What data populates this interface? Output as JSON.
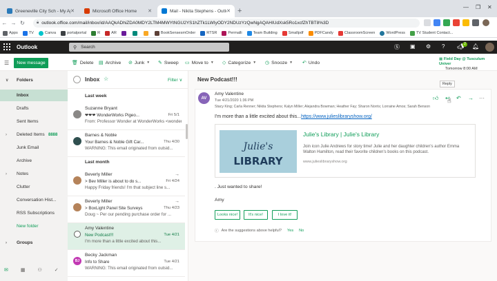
{
  "browser": {
    "tabs": [
      {
        "title": "Greeneville City Sch - My Apps",
        "color": "#2a7ab9"
      },
      {
        "title": "Microsoft Office Home",
        "color": "#d83b01"
      },
      {
        "title": "Mail - Nikita Stephens - Outlook",
        "color": "#0078d4"
      }
    ],
    "new_tab": "+",
    "url": "outlook.office.com/mail/inbox/id/AAQkADhiZDA0MDY2LTM4MWYtNGU2YS1hZTk1LWIyODY2NDUzYzQwNgAQAHIUdXsk5Ro1xcfZhTBT8%3D",
    "bookmarks": [
      {
        "label": "Apps",
        "color": "#5f6368"
      },
      {
        "label": "TV",
        "color": "#1a73e8"
      },
      {
        "label": "Canva",
        "color": "#00c4cc"
      },
      {
        "label": "portalportal",
        "color": "#3c4043"
      },
      {
        "label": "R",
        "color": "#2e7d32"
      },
      {
        "label": "AR",
        "color": "#c62828"
      },
      {
        "label": "",
        "color": "#6a1b9a"
      },
      {
        "label": "",
        "color": "#00897b"
      },
      {
        "label": "",
        "color": "#f9a825"
      },
      {
        "label": "BookSensesmOrder",
        "color": "#5d4037"
      },
      {
        "label": "RTSR",
        "color": "#1565c0"
      },
      {
        "label": "Permalli",
        "color": "#ad1457"
      },
      {
        "label": "Team Building",
        "color": "#1e88e5"
      },
      {
        "label": "Smallpdf",
        "color": "#e53935"
      },
      {
        "label": "PDFCandy",
        "color": "#fb8c00"
      },
      {
        "label": "ClassroomScreen",
        "color": "#e53935"
      },
      {
        "label": "WordPress",
        "color": "#21759b"
      },
      {
        "label": "TV Student Contact...",
        "color": "#43a047"
      }
    ]
  },
  "outlook": {
    "brand": "Outlook",
    "search_placeholder": "Search",
    "notification_count": "2"
  },
  "toolbar": {
    "new_message": "New message",
    "delete": "Delete",
    "archive": "Archive",
    "junk": "Junk",
    "sweep": "Sweep",
    "move_to": "Move to",
    "categorize": "Categorize",
    "snooze": "Snooze",
    "undo": "Undo",
    "event_title": "Field Day @ Tusculum Univer",
    "event_time": "Tomorrow 8:00 AM"
  },
  "nav": {
    "folders_label": "Folders",
    "items": [
      {
        "label": "Inbox"
      },
      {
        "label": "Drafts"
      },
      {
        "label": "Sent Items"
      },
      {
        "label": "Deleted Items",
        "count": "8888"
      },
      {
        "label": "Junk Email"
      },
      {
        "label": "Archive"
      },
      {
        "label": "Notes"
      },
      {
        "label": "Clutter"
      },
      {
        "label": "Conversation Hist..."
      },
      {
        "label": "RSS Subscriptions"
      },
      {
        "label": "New folder"
      }
    ],
    "groups_label": "Groups"
  },
  "list": {
    "title": "Inbox",
    "filter": "Filter",
    "group_last_week": "Last week",
    "group_last_month": "Last month",
    "messages": [
      {
        "from": "Suzanne Bryant",
        "subject": "❤❤❤ WonderWorks Pigeo...",
        "date": "Fri 5/1",
        "preview": "From: Professor Wonder at WonderWorks <wonder...",
        "avatar_color": "#8a8886"
      },
      {
        "from": "Barnes & Noble",
        "subject": "Your Barnes & Noble Gift Car...",
        "date": "Thu 4/30",
        "preview": "WARNING: This email originated from outsid...",
        "avatar_color": "#2f4f4f"
      },
      {
        "from": "Beverly Miller",
        "subject": "> Bev Miller is about to do s...",
        "date": "Fri 4/24",
        "preview": "Happy Friday friends! I'm that subject line s...",
        "avatar_color": "#b5835a"
      },
      {
        "from": "Beverly Miller",
        "subject": "> BoxLight Panel Site Surveys",
        "date": "Thu 4/23",
        "preview": "Doug ~ Per our pending purchase order for ...",
        "avatar_color": "#b5835a"
      },
      {
        "from": "Amy Valentine",
        "subject": "New Podcast!!!",
        "date": "Tue 4/21",
        "preview": "I'm more than a little excited about this...",
        "avatar_color": "#8764b8"
      },
      {
        "from": "Becky Jackman",
        "subject": "Info to Share",
        "date": "Tue 4/21",
        "preview": "WARNING: This email originated from outsid...",
        "avatar_color": "#c239b3",
        "initials": "BJ"
      }
    ]
  },
  "reading": {
    "subject": "New Podcast!!!",
    "avatar_initials": "AV",
    "sender": "Amy Valentine",
    "date": "Tue 4/21/2020 1:36 PM",
    "to": "Stacy King; Carla Renner; Nikita Stephens; Kalyn Miller; Alejandra Bowman; Heather Fay; Sharon Norris; Lorraine Amos; Sarah Benson",
    "tooltip": "Reply",
    "body_intro": "I'm more than a little excited about this...",
    "body_link": "https://www.julieslibraryshow.org/",
    "preview": {
      "logo_line1": "Julie's",
      "logo_line2": "LIBRARY",
      "title": "Julie's Library | Julie's Library",
      "description": "Join icon Julie Andrews for story time! Julie and her daughter children's author Emma Walton Hamilton, read their favorite children's books on this podcast.",
      "url": "www.julieslibraryshow.org"
    },
    "body_outro": ". Just wanted to share!",
    "signature": "Amy",
    "suggestions": [
      "Looks nice!",
      "It's nice!",
      "I love it!"
    ],
    "helpful_question": "Are the suggestions above helpful?",
    "yes": "Yes",
    "no": "No"
  }
}
